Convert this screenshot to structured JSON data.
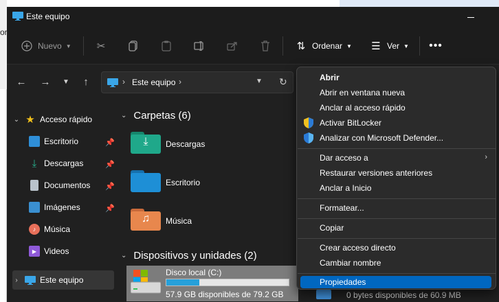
{
  "background": {
    "left_text": "or"
  },
  "window": {
    "title": "Este equipo"
  },
  "toolbar": {
    "new_label": "Nuevo",
    "sort_label": "Ordenar",
    "view_label": "Ver"
  },
  "address": {
    "path_item": "Este equipo"
  },
  "sidebar": {
    "quick_access": "Acceso rápido",
    "items": [
      {
        "label": "Escritorio",
        "icon": "desktop-icon",
        "pinned": true
      },
      {
        "label": "Descargas",
        "icon": "download-icon",
        "pinned": true
      },
      {
        "label": "Documentos",
        "icon": "document-icon",
        "pinned": true
      },
      {
        "label": "Imágenes",
        "icon": "image-icon",
        "pinned": true
      },
      {
        "label": "Música",
        "icon": "music-icon",
        "pinned": false
      },
      {
        "label": "Videos",
        "icon": "video-icon",
        "pinned": false
      }
    ],
    "this_pc": "Este equipo"
  },
  "main": {
    "folders_header": "Carpetas (6)",
    "folders": [
      {
        "label": "Descargas",
        "color": "#1fa88a"
      },
      {
        "label": "Escritorio",
        "color": "#1e8fd6"
      },
      {
        "label": "Música",
        "color": "#e8874d"
      }
    ],
    "devices_header": "Dispositivos y unidades (2)",
    "drive": {
      "name": "Disco local (C:)",
      "space": "57.9 GB disponibles de 79.2 GB",
      "used_fraction": 0.27
    },
    "drive2_space": "0 bytes disponibles de 60.9 MB"
  },
  "context_menu": {
    "items": [
      {
        "label": "Abrir",
        "bold": true
      },
      {
        "label": "Abrir en ventana nueva"
      },
      {
        "label": "Anclar al acceso rápido"
      },
      {
        "label": "Activar BitLocker",
        "icon": "shield-icon"
      },
      {
        "label": "Analizar con Microsoft Defender...",
        "icon": "shield-icon"
      },
      {
        "label": "Dar acceso a",
        "submenu": true
      },
      {
        "label": "Restaurar versiones anteriores"
      },
      {
        "label": "Anclar a Inicio"
      },
      {
        "label": "Formatear..."
      },
      {
        "label": "Copiar"
      },
      {
        "label": "Crear acceso directo"
      },
      {
        "label": "Cambiar nombre"
      },
      {
        "label": "Propiedades",
        "highlighted": true
      }
    ]
  },
  "colors": {
    "accent": "#0067c0",
    "window_bg": "#202020",
    "menu_bg": "#2b2b2b",
    "drive_bar": "#26a0da"
  }
}
